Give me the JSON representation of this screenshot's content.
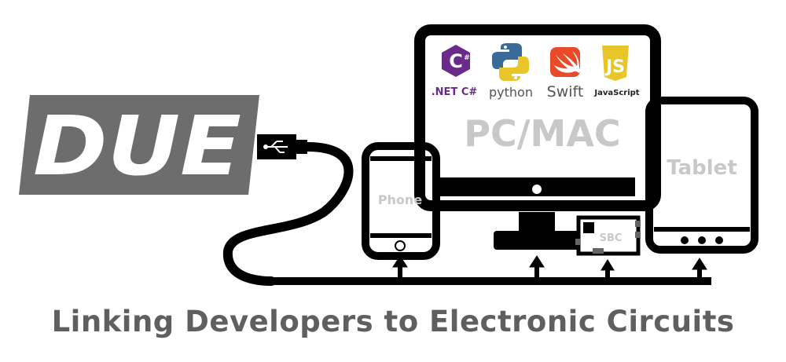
{
  "logo": {
    "text": "DUE",
    "color": "#6d6d6d"
  },
  "languages": [
    {
      "label": ".NET C#",
      "icon": "csharp-icon",
      "color": "#6a2a8a"
    },
    {
      "label": "python",
      "icon": "python-icon",
      "color": "#3a6a9a"
    },
    {
      "label": "Swift",
      "icon": "swift-icon",
      "color": "#e84a2a"
    },
    {
      "label": "JavaScript",
      "icon": "javascript-icon",
      "color": "#e8c62a"
    }
  ],
  "devices": {
    "pc": "PC/MAC",
    "phone": "Phone",
    "tablet": "Tablet",
    "sbc": "SBC"
  },
  "tagline": "Linking Developers to Electronic Circuits",
  "colors": {
    "line": "#000000",
    "label": "#c8c8c8",
    "tagline": "#5f5f5f"
  }
}
